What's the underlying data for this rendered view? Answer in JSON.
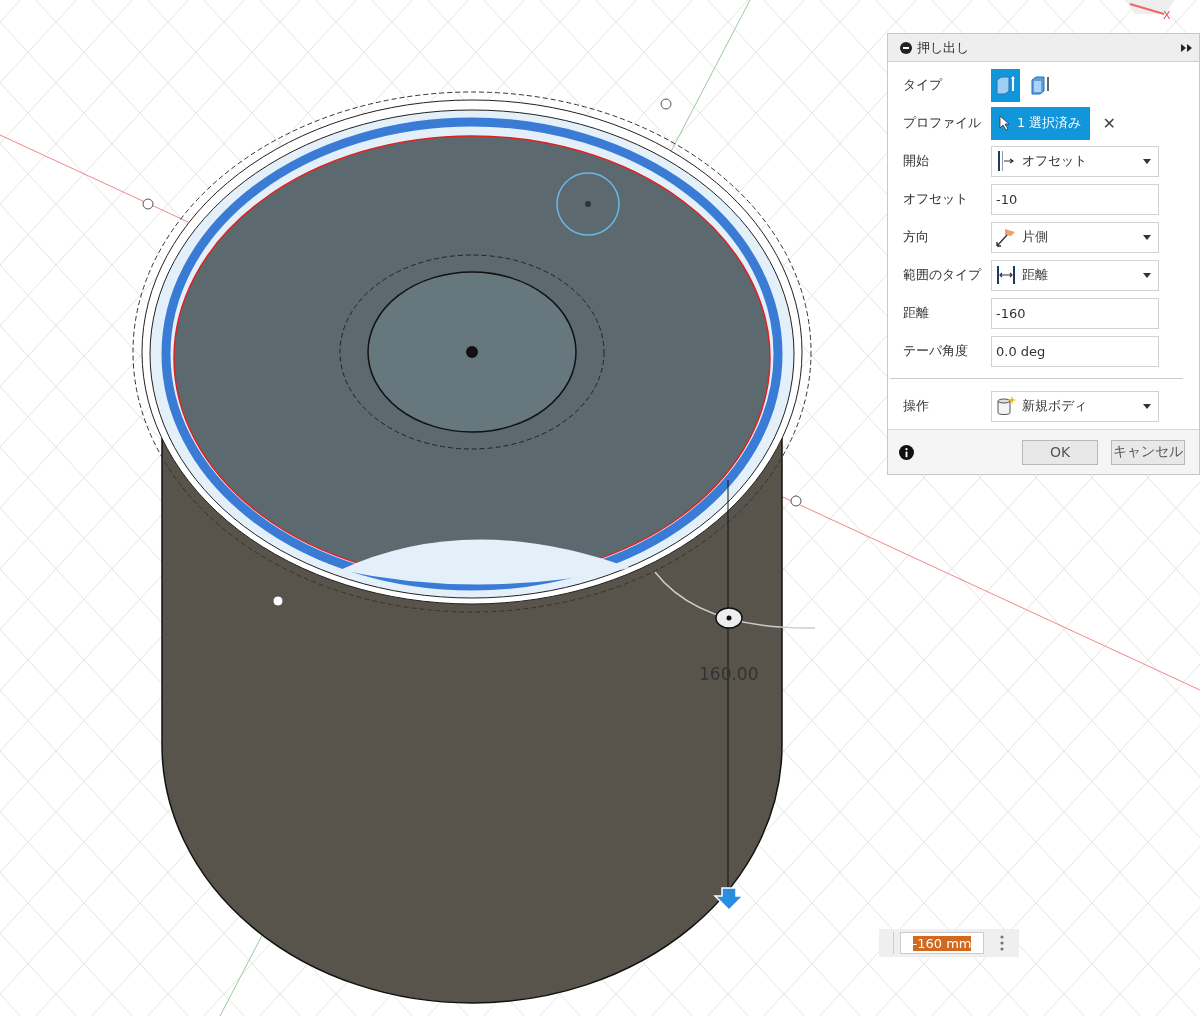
{
  "viewcube": {
    "axis_label": "X"
  },
  "panel": {
    "title": "押し出し",
    "rows": [
      {
        "kind": "icons",
        "label": "タイプ",
        "options": [
          {
            "selected": true
          },
          {
            "selected": false
          }
        ]
      },
      {
        "kind": "selection",
        "label": "プロファイル",
        "value": "1 選択済み",
        "clear": "✕"
      },
      {
        "kind": "dropdown",
        "label": "開始",
        "value": "オフセット"
      },
      {
        "kind": "input",
        "label": "オフセット",
        "value": "-10"
      },
      {
        "kind": "dropdown",
        "label": "方向",
        "value": "片側"
      },
      {
        "kind": "dropdown",
        "label": "範囲のタイプ",
        "value": "距離"
      },
      {
        "kind": "input",
        "label": "距離",
        "value": "-160"
      },
      {
        "kind": "input",
        "label": "テーパ角度",
        "value": "0.0 deg"
      },
      {
        "kind": "separator"
      },
      {
        "kind": "dropdown",
        "label": "操作",
        "value": "新規ボディ"
      }
    ],
    "buttons": [
      "OK",
      "キャンセル"
    ]
  },
  "dimension": {
    "label": "160.00",
    "input_value": "-160 mm"
  }
}
